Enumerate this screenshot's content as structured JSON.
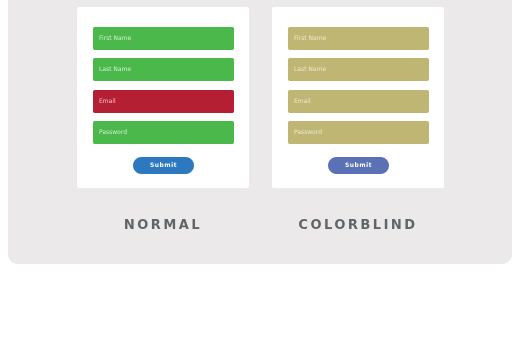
{
  "normal": {
    "caption": "NORMAL",
    "fields": [
      {
        "placeholder": "First Name",
        "color": "#4ab84a"
      },
      {
        "placeholder": "Last Name",
        "color": "#4ab84a"
      },
      {
        "placeholder": "Email",
        "color": "#b51f33"
      },
      {
        "placeholder": "Password",
        "color": "#4ab84a"
      }
    ],
    "submit_label": "Submit",
    "submit_color": "#2c79bf"
  },
  "colorblind": {
    "caption": "COLORBLIND",
    "fields": [
      {
        "placeholder": "First Name",
        "color": "#bfb674"
      },
      {
        "placeholder": "Last Name",
        "color": "#bfb674"
      },
      {
        "placeholder": "Email",
        "color": "#bfb674"
      },
      {
        "placeholder": "Password",
        "color": "#bfb674"
      }
    ],
    "submit_label": "Submit",
    "submit_color": "#5a71b6"
  },
  "colors": {
    "panel_background": "#ebe9e9",
    "card_background": "#ffffff",
    "caption_text": "#5f6469",
    "normal_placeholder_text": "#d7f0d7",
    "colorblind_placeholder_text": "#eeead0"
  }
}
